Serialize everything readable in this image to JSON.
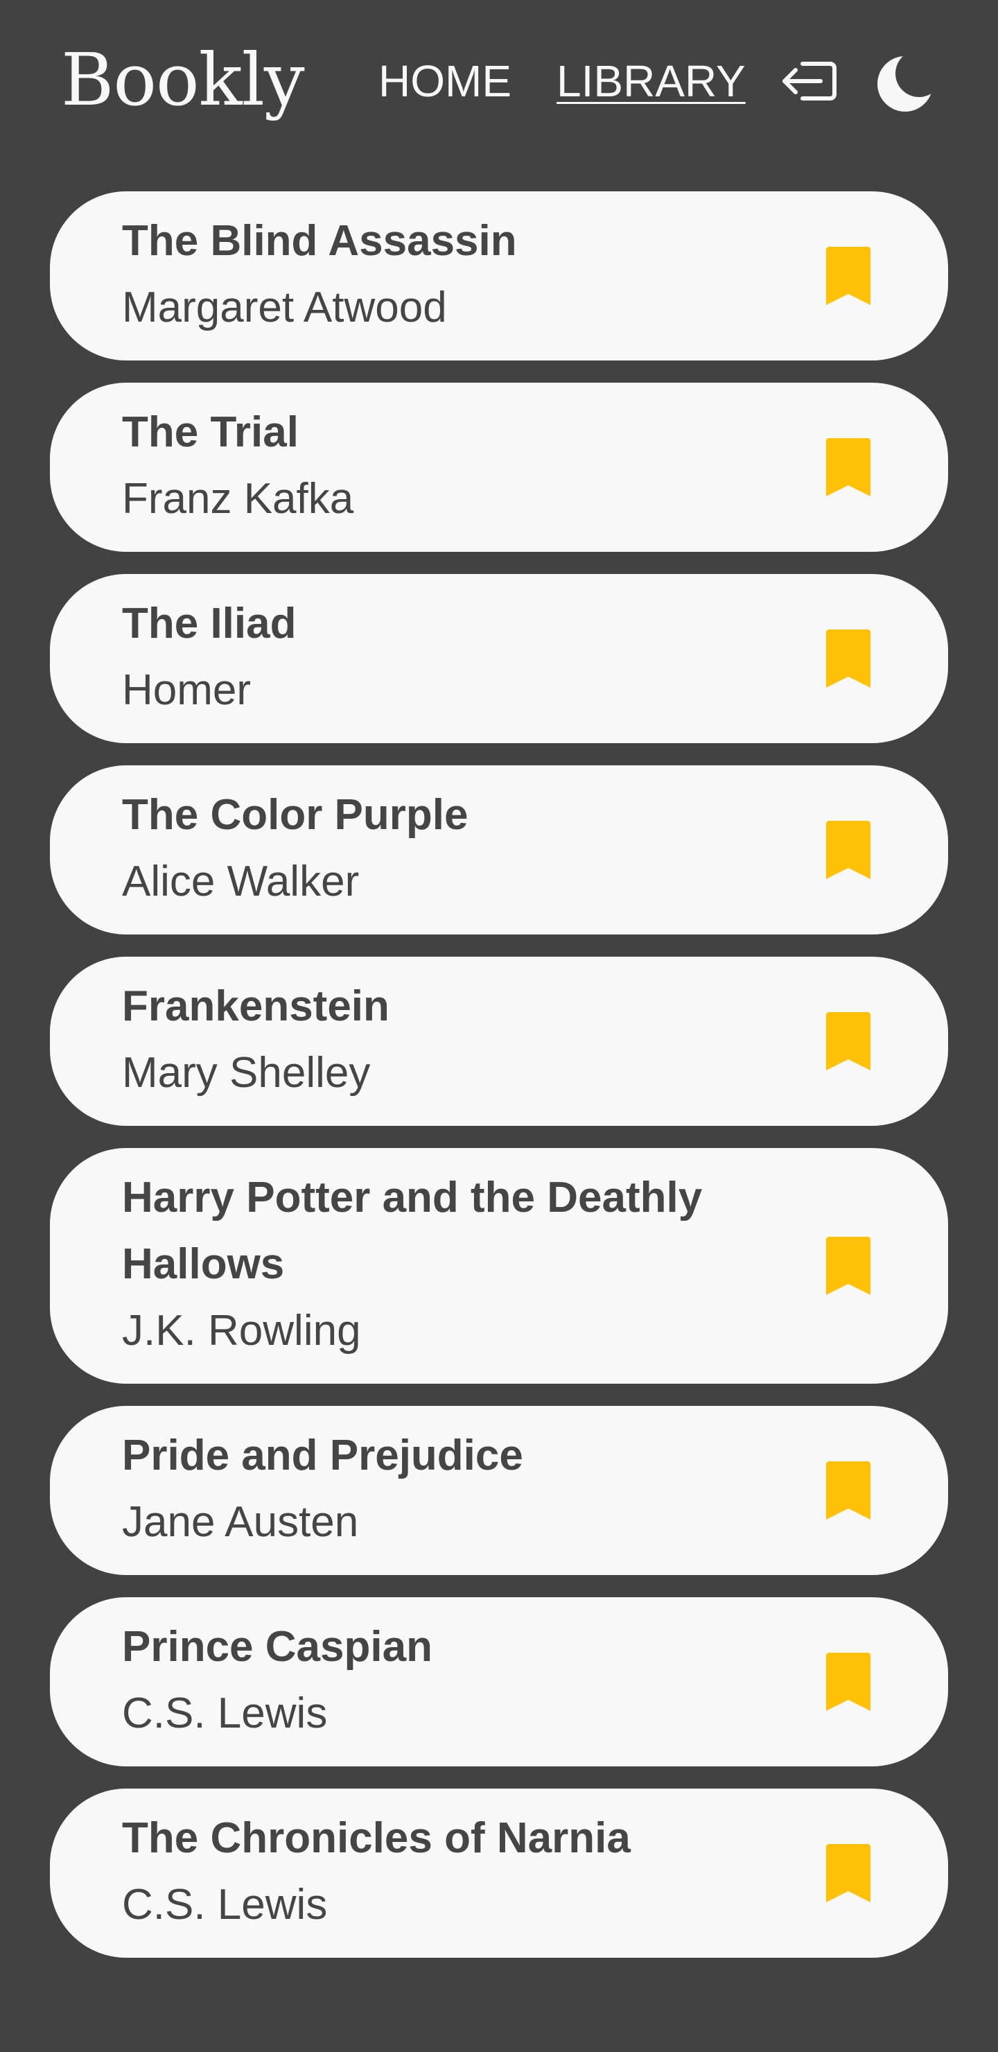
{
  "header": {
    "logo": "Bookly",
    "nav": {
      "home": "HOME",
      "library": "LIBRARY"
    },
    "icons": {
      "logout": "logout-icon",
      "theme": "moon-icon"
    }
  },
  "colors": {
    "background": "#424242",
    "card": "#f8f8f8",
    "text": "#454545",
    "bookmark": "#ffc107",
    "header_text": "#f7f7f7"
  },
  "books": [
    {
      "title": "The Blind Assassin",
      "author": "Margaret Atwood"
    },
    {
      "title": "The Trial",
      "author": "Franz Kafka"
    },
    {
      "title": "The Iliad",
      "author": "Homer"
    },
    {
      "title": "The Color Purple",
      "author": "Alice Walker"
    },
    {
      "title": "Frankenstein",
      "author": "Mary Shelley"
    },
    {
      "title": "Harry Potter and the Deathly Hallows",
      "author": "J.K. Rowling"
    },
    {
      "title": "Pride and Prejudice",
      "author": "Jane Austen"
    },
    {
      "title": "Prince Caspian",
      "author": "C.S. Lewis"
    },
    {
      "title": "The Chronicles of Narnia",
      "author": "C.S. Lewis"
    }
  ]
}
